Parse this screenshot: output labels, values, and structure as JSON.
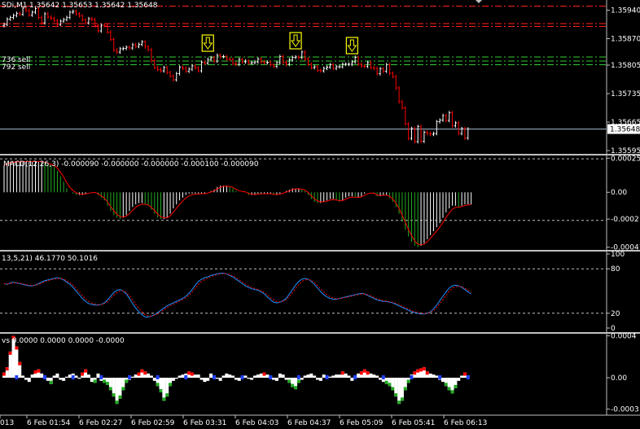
{
  "window": {
    "title": "SDi,M1",
    "ohlc": "1.35642 1.35653 1.35642 1.35648"
  },
  "order_labels": [
    "736 sell",
    "792 sell"
  ],
  "colors": {
    "background": "#000000",
    "bull": "#FFFFFF",
    "bear": "#FF0000",
    "price_line": "#A0B4C8",
    "red_level": "#FF2020",
    "green_level": "#33CC33",
    "macd_up": "#FFFFFF",
    "macd_down": "#22AA22",
    "macd_signal": "#FF0000",
    "stoch_main": "#1E90FF",
    "stoch_signal": "#FF0000",
    "arrow_box": "#FFFF00"
  },
  "chart_data": [
    {
      "type": "candlestick",
      "name": "price",
      "y_ticks": [
        "1.35940",
        "1.35870",
        "1.35805",
        "1.35735",
        "1.35665",
        "1.35595"
      ],
      "ylim": [
        1.35585,
        1.35965
      ],
      "current_price": "1.35648",
      "current_value": 1.35648,
      "red_levels": [
        1.3595,
        1.35907,
        1.359
      ],
      "green_levels": [
        1.35825,
        1.35815,
        1.35806
      ],
      "signal_arrows_at_bar": [
        65,
        93,
        111
      ],
      "close": [
        1.35905,
        1.35918,
        1.35922,
        1.35927,
        1.35932,
        1.3593,
        1.35945,
        1.35939,
        1.35928,
        1.35935,
        1.35944,
        1.35922,
        1.35909,
        1.35931,
        1.35923,
        1.3592,
        1.35914,
        1.35905,
        1.35913,
        1.35917,
        1.35922,
        1.35935,
        1.35937,
        1.35931,
        1.35926,
        1.35916,
        1.35909,
        1.35919,
        1.35917,
        1.35902,
        1.35889,
        1.35903,
        1.35902,
        1.35886,
        1.35868,
        1.35842,
        1.35837,
        1.35845,
        1.35846,
        1.35849,
        1.35847,
        1.35855,
        1.35851,
        1.35856,
        1.35862,
        1.3585,
        1.35843,
        1.35816,
        1.35799,
        1.35794,
        1.35791,
        1.35799,
        1.35787,
        1.35778,
        1.35769,
        1.35784,
        1.358,
        1.35797,
        1.3579,
        1.35795,
        1.35803,
        1.35798,
        1.35791,
        1.35812,
        1.3581,
        1.35819,
        1.35823,
        1.35815,
        1.35829,
        1.35826,
        1.35826,
        1.3582,
        1.35819,
        1.35809,
        1.35807,
        1.35819,
        1.35813,
        1.35815,
        1.3581,
        1.35811,
        1.35813,
        1.3582,
        1.35813,
        1.35811,
        1.35812,
        1.35806,
        1.35802,
        1.35811,
        1.35826,
        1.35812,
        1.35807,
        1.35818,
        1.35824,
        1.35825,
        1.35824,
        1.35837,
        1.3582,
        1.35807,
        1.35799,
        1.35801,
        1.35792,
        1.35791,
        1.35797,
        1.358,
        1.35806,
        1.35797,
        1.35801,
        1.35801,
        1.35807,
        1.35807,
        1.35807,
        1.35813,
        1.35824,
        1.35807,
        1.35803,
        1.35802,
        1.35811,
        1.35799,
        1.35797,
        1.35784,
        1.35796,
        1.3579,
        1.35806,
        1.35785,
        1.35777,
        1.35749,
        1.35715,
        1.357,
        1.35661,
        1.35625,
        1.35649,
        1.35617,
        1.35654,
        1.35618,
        1.3564,
        1.35637,
        1.35635,
        1.35637,
        1.35666,
        1.3567,
        1.35681,
        1.35669,
        1.35688,
        1.35656,
        1.35663,
        1.35637,
        1.35649,
        1.35626,
        1.35648
      ],
      "x_ticks": [
        "013",
        "6 Feb 01:54",
        "6 Feb 02:27",
        "6 Feb 02:59",
        "6 Feb 03:31",
        "6 Feb 04:03",
        "6 Feb 04:37",
        "6 Feb 05:09",
        "6 Feb 05:41",
        "6 Feb 06:13"
      ]
    },
    {
      "type": "bar",
      "name": "MACD",
      "title": "MACD(12,26,3) -0.000090 -0.000000 -0.000000 -0.000100 -0.000090",
      "y_ticks": [
        "0.000255",
        "0.00",
        "-0.0002",
        "-0.00041"
      ],
      "ylim": [
        -0.00043,
        0.000275
      ],
      "dashed_levels": [
        0.00025,
        -0.00021
      ],
      "values": [
        0.0002,
        0.00022,
        0.00023,
        0.00023,
        0.00023,
        0.00023,
        0.00023,
        0.00023,
        0.00023,
        0.00023,
        0.00023,
        0.00023,
        0.00023,
        0.00022,
        0.00021,
        0.0002,
        0.00019,
        0.00016,
        0.00012,
        8e-05,
        3e-05,
        0,
        -1e-05,
        -2e-05,
        -2e-05,
        -2e-05,
        -1e-05,
        0,
        0,
        0,
        -2e-05,
        -4e-05,
        -6e-05,
        -0.0001,
        -0.00014,
        -0.00017,
        -0.00019,
        -0.0002,
        -0.00019,
        -0.00017,
        -0.00014,
        -0.00011,
        -9e-05,
        -8e-05,
        -8e-05,
        -9e-05,
        -0.0001,
        -0.00013,
        -0.00016,
        -0.00019,
        -0.0002,
        -0.0002,
        -0.00019,
        -0.00016,
        -0.00012,
        -9e-05,
        -6e-05,
        -4e-05,
        -2e-05,
        -1e-05,
        -1e-05,
        -1e-05,
        -1e-05,
        -1e-05,
        -1e-05,
        0,
        1e-05,
        2e-05,
        4e-05,
        5e-05,
        5e-05,
        5e-05,
        4e-05,
        3e-05,
        1e-05,
        0,
        0,
        0,
        -2e-05,
        -2e-05,
        -2e-05,
        -1e-05,
        -1e-05,
        -1e-05,
        -1e-05,
        -1e-05,
        -2e-05,
        -2e-05,
        -1e-05,
        0,
        1e-05,
        2e-05,
        3e-05,
        3e-05,
        3e-05,
        2e-05,
        1e-05,
        -2e-05,
        -5e-05,
        -7e-05,
        -8e-05,
        -8e-05,
        -7e-05,
        -6e-05,
        -5e-05,
        -5e-05,
        -6e-05,
        -7e-05,
        -6e-05,
        -4e-05,
        -3e-05,
        -3e-05,
        -4e-05,
        -4e-05,
        -3e-05,
        -1e-05,
        0,
        0,
        -1e-05,
        -3e-05,
        -3e-05,
        -2e-05,
        -2e-05,
        -4e-05,
        -7e-05,
        -0.00011,
        -0.00016,
        -0.00022,
        -0.00028,
        -0.00033,
        -0.00037,
        -0.0004,
        -0.00041,
        -0.0004,
        -0.00038,
        -0.00035,
        -0.00032,
        -0.00029,
        -0.00026,
        -0.00023,
        -0.00019,
        -0.00015,
        -0.00012,
        -0.0001,
        -0.0001,
        -0.00011,
        -0.0001,
        -9e-05,
        -9e-05,
        -9e-05
      ]
    },
    {
      "type": "line",
      "name": "Stochastic",
      "title": "13,5,21) 46.1770 50.1016",
      "y_ticks": [
        "100",
        "80",
        "20",
        "0"
      ],
      "ylim": [
        0,
        100
      ],
      "dashed_levels": [
        80,
        20
      ],
      "series": [
        {
          "values": [
            60,
            59,
            61,
            62,
            61,
            60,
            59,
            58,
            57,
            57,
            58,
            60,
            62,
            64,
            65,
            66,
            67,
            68,
            67,
            65,
            62,
            59,
            55,
            50,
            45,
            40,
            36,
            33,
            32,
            31,
            31,
            32,
            34,
            38,
            43,
            48,
            51,
            52,
            50,
            46,
            40,
            33,
            27,
            22,
            18,
            15,
            15,
            16,
            18,
            21,
            24,
            27,
            30,
            32,
            34,
            36,
            38,
            40,
            43,
            47,
            52,
            58,
            63,
            66,
            68,
            69,
            71,
            72,
            73,
            74,
            74,
            73,
            71,
            69,
            66,
            63,
            60,
            57,
            55,
            53,
            52,
            51,
            49,
            46,
            42,
            38,
            35,
            34,
            35,
            37,
            40,
            46,
            52,
            58,
            63,
            66,
            67,
            66,
            63,
            59,
            54,
            49,
            45,
            42,
            40,
            39,
            39,
            40,
            41,
            42,
            43,
            44,
            45,
            46,
            47,
            46,
            44,
            42,
            40,
            38,
            37,
            36,
            36,
            35,
            34,
            32,
            30,
            28,
            26,
            24,
            22,
            21,
            20,
            19,
            19,
            20,
            22,
            26,
            31,
            37,
            43,
            49,
            54,
            57,
            58,
            57,
            55,
            52,
            49,
            46
          ]
        }
      ]
    },
    {
      "type": "bar",
      "name": "Volumes",
      "title": "vs 0.0000 0.0000 0.0000 -0.0000",
      "y_ticks": [
        "0.0004",
        "0.00",
        "-0.0003"
      ],
      "ylim": [
        -0.00035,
        0.00042
      ],
      "values": [
        5e-05,
        0.0001,
        0.00025,
        0.0004,
        0.0003,
        0.00015,
        2e-05,
        -2e-05,
        -4e-05,
        3e-05,
        7e-05,
        8e-05,
        4e-05,
        1e-05,
        -3e-05,
        -6e-05,
        2e-05,
        4e-05,
        -2e-05,
        -3e-05,
        1e-05,
        3e-05,
        4e-05,
        2e-05,
        -1e-05,
        5e-05,
        8e-05,
        3e-05,
        -4e-05,
        -5e-05,
        4e-05,
        -3e-05,
        -5e-05,
        -7e-05,
        -0.00012,
        -0.00018,
        -0.00025,
        -0.0002,
        -0.00012,
        -5e-05,
        -2e-05,
        1e-05,
        3e-05,
        5e-05,
        8e-05,
        6e-05,
        4e-05,
        2e-05,
        -3e-05,
        -8e-05,
        -0.00014,
        -0.00022,
        -0.00018,
        -8e-05,
        -3e-05,
        -1e-05,
        2e-05,
        3e-05,
        4e-05,
        6e-05,
        5e-05,
        3e-05,
        3e-05,
        -2e-05,
        -4e-05,
        -3e-05,
        4e-05,
        2e-05,
        -1e-05,
        -3e-05,
        2e-05,
        4e-05,
        3e-05,
        2e-05,
        -2e-05,
        -3e-05,
        1e-05,
        2e-05,
        -1e-05,
        -2e-05,
        2e-05,
        3e-05,
        4e-05,
        5e-05,
        3e-05,
        2e-05,
        -2e-05,
        -3e-05,
        4e-05,
        3e-05,
        -2e-05,
        -5e-05,
        -9e-05,
        -0.00011,
        -5e-05,
        -2e-05,
        2e-05,
        3e-05,
        4e-05,
        2e-05,
        -2e-05,
        -3e-05,
        3e-05,
        2e-05,
        1e-05,
        2e-05,
        3e-05,
        3e-05,
        6e-05,
        4e-05,
        2e-05,
        -3e-05,
        2e-05,
        4e-05,
        6e-05,
        8e-05,
        6e-05,
        4e-05,
        3e-05,
        2e-05,
        -2e-05,
        -4e-05,
        -6e-05,
        -8e-05,
        -0.00012,
        -0.00018,
        -0.00025,
        -0.00022,
        -0.00012,
        -5e-05,
        3e-05,
        6e-05,
        8e-05,
        9e-05,
        0.0001,
        6e-05,
        4e-05,
        3e-05,
        2e-05,
        -2e-05,
        -4e-05,
        -8e-05,
        -0.00012,
        -0.00015,
        -0.0001,
        -3e-05,
        2e-05,
        5e-05,
        2e-05
      ]
    }
  ]
}
